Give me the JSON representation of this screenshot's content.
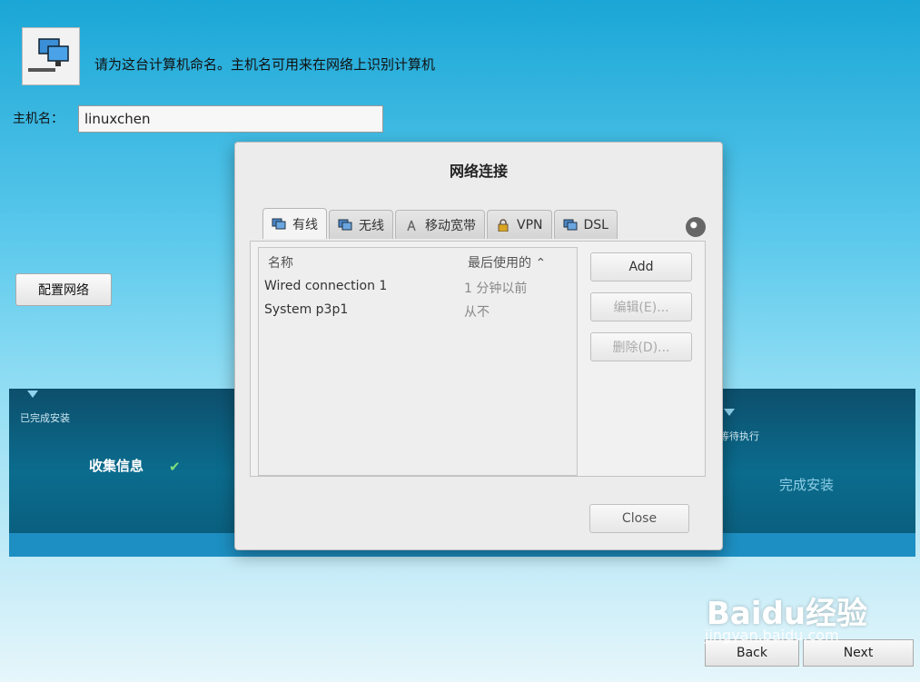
{
  "hostname_prompt": "请为这台计算机命名。主机名可用来在网络上识别计算机",
  "hostname_label": "主机名：",
  "hostname_value": "linuxchen",
  "config_network_button": "配置网络",
  "progress": {
    "done_label": "已完成安装",
    "current_step": "收集信息",
    "waiting_label": "等待执行",
    "next_step": "完成安装"
  },
  "dialog": {
    "title": "网络连接",
    "tabs": [
      {
        "label": "有线",
        "active": true
      },
      {
        "label": "无线",
        "active": false
      },
      {
        "label": "移动宽带",
        "active": false
      },
      {
        "label": "VPN",
        "active": false
      },
      {
        "label": "DSL",
        "active": false
      }
    ],
    "columns": {
      "name": "名称",
      "last_used": "最后使用的"
    },
    "rows": [
      {
        "name": "Wired connection 1",
        "last_used": "1 分钟以前"
      },
      {
        "name": "System p3p1",
        "last_used": "从不"
      }
    ],
    "buttons": {
      "add": "Add",
      "edit": "编辑(E)...",
      "delete": "删除(D)...",
      "close": "Close"
    }
  },
  "nav": {
    "back": "Back",
    "next": "Next"
  },
  "watermark": {
    "brand": "Baidu经验",
    "url": "jingyan.baidu.com"
  }
}
